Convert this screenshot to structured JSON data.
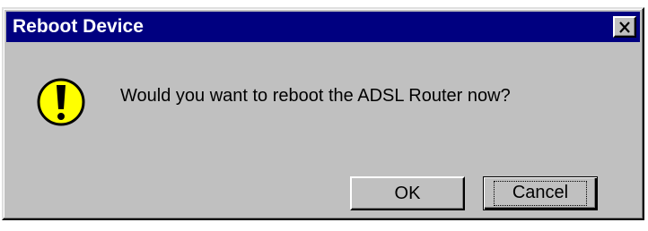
{
  "dialog": {
    "title": "Reboot Device",
    "message": "Would you want to reboot the ADSL Router now?",
    "icon": "warning-exclamation-icon"
  },
  "buttons": {
    "ok_label": "OK",
    "cancel_label": "Cancel"
  },
  "colors": {
    "titlebar": "#000080",
    "dialog_bg": "#c0c0c0",
    "icon_fill": "#ffff00"
  }
}
